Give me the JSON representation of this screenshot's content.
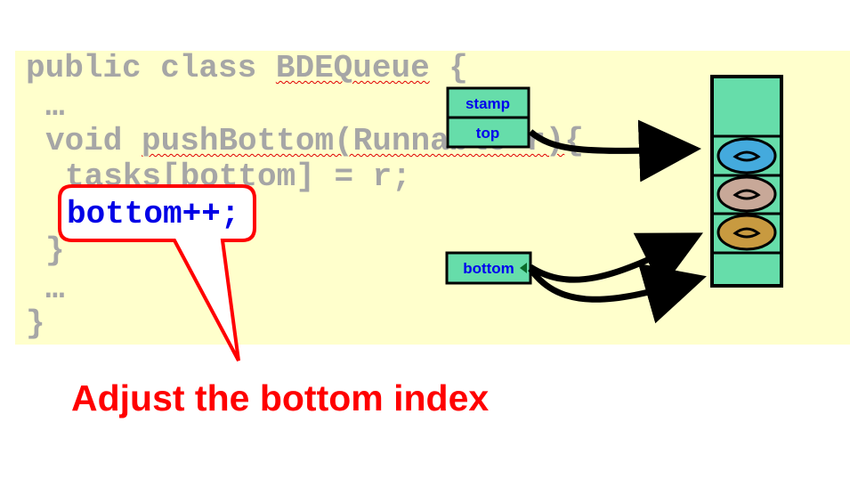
{
  "code": {
    "line1_kw": "public class ",
    "line1_name": "BDEQueue",
    "line1_end": " {",
    "line2": "…",
    "line3_kw": "void ",
    "line3_method": "pushBottom(Runnable r)",
    "line3_end": "{",
    "line4": "tasks[bottom] = r;",
    "line5": "bottom++;",
    "line6": "}",
    "line7": "…",
    "line8": "}"
  },
  "diagram": {
    "stamp_label": "stamp",
    "top_label": "top",
    "bottom_label": "bottom"
  },
  "caption": "Adjust the bottom index",
  "colors": {
    "panel": "#ffffcc",
    "box_fill": "#66ddaa",
    "callout": "#ff0000",
    "highlight_code": "#0000e6",
    "task_blue": "#44aadd",
    "task_pink": "#c8a898",
    "task_gold": "#c89a40"
  }
}
